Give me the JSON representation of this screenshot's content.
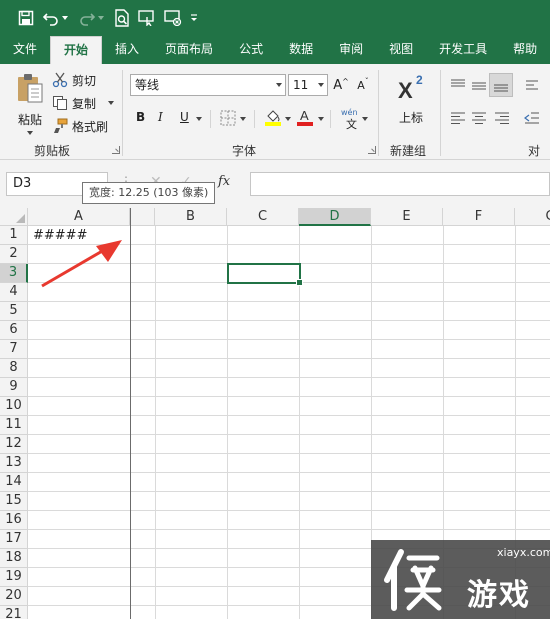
{
  "tabs": [
    "文件",
    "开始",
    "插入",
    "页面布局",
    "公式",
    "数据",
    "审阅",
    "视图",
    "开发工具",
    "帮助"
  ],
  "active_tab": "开始",
  "clipboard": {
    "paste_label": "粘贴",
    "cut_label": "剪切",
    "copy_label": "复制",
    "format_painter_label": "格式刷",
    "group_label": "剪贴板"
  },
  "font": {
    "font_name": "等线",
    "font_size": "11",
    "group_label": "字体",
    "bold": "B",
    "italic": "I",
    "underline": "U",
    "grow": "A",
    "shrink": "A",
    "phonetic": "wén"
  },
  "new_group": {
    "superscript_label": "上标",
    "group_label": "新建组"
  },
  "alignment": {
    "group_label": "对齐"
  },
  "formula_bar": {
    "name_box": "D3",
    "fx": "fx",
    "tooltip": "宽度: 12.25 (103 像素)"
  },
  "sheet": {
    "columns": [
      "A",
      "B",
      "C",
      "D",
      "E",
      "F",
      "G"
    ],
    "selected_column": "D",
    "rows": [
      "1",
      "2",
      "3",
      "4",
      "5",
      "6",
      "7",
      "8",
      "9",
      "10",
      "11",
      "12",
      "13",
      "14",
      "15",
      "16",
      "17",
      "18",
      "19",
      "20",
      "21"
    ],
    "selected_row": "3",
    "cell_a1": "#####"
  },
  "watermark": {
    "url": "xiayx.com",
    "text": "游戏"
  },
  "colors": {
    "excel_green": "#217346",
    "annotation_red": "#e8392f"
  }
}
